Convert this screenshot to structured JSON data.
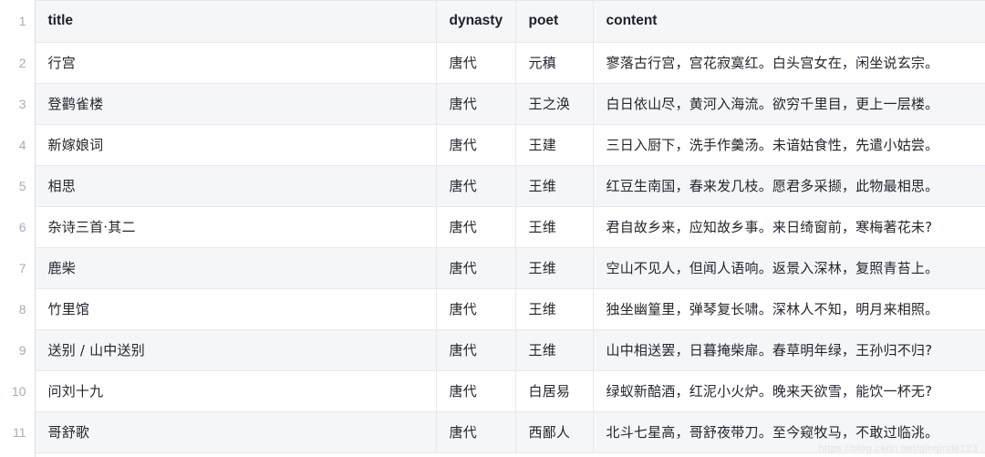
{
  "table": {
    "columns": [
      {
        "key": "title",
        "label": "title"
      },
      {
        "key": "dynasty",
        "label": "dynasty"
      },
      {
        "key": "poet",
        "label": "poet"
      },
      {
        "key": "content",
        "label": "content"
      }
    ],
    "header_row_number": "1",
    "row_numbers": [
      "2",
      "3",
      "4",
      "5",
      "6",
      "7",
      "8",
      "9",
      "10",
      "11"
    ],
    "rows": [
      {
        "n": "2",
        "title": "行宫",
        "dynasty": "唐代",
        "poet": "元稹",
        "content": "寥落古行宫，宫花寂寞红。白头宫女在，闲坐说玄宗。"
      },
      {
        "n": "3",
        "title": "登鹳雀楼",
        "dynasty": "唐代",
        "poet": "王之涣",
        "content": "白日依山尽，黄河入海流。欲穷千里目，更上一层楼。"
      },
      {
        "n": "4",
        "title": "新嫁娘词",
        "dynasty": "唐代",
        "poet": "王建",
        "content": "三日入厨下，洗手作羹汤。未谙姑食性，先遣小姑尝。"
      },
      {
        "n": "5",
        "title": "相思",
        "dynasty": "唐代",
        "poet": "王维",
        "content": "红豆生南国，春来发几枝。愿君多采撷，此物最相思。"
      },
      {
        "n": "6",
        "title": "杂诗三首·其二",
        "dynasty": "唐代",
        "poet": "王维",
        "content": "君自故乡来，应知故乡事。来日绮窗前，寒梅著花未?"
      },
      {
        "n": "7",
        "title": "鹿柴",
        "dynasty": "唐代",
        "poet": "王维",
        "content": "空山不见人，但闻人语响。返景入深林，复照青苔上。"
      },
      {
        "n": "8",
        "title": "竹里馆",
        "dynasty": "唐代",
        "poet": "王维",
        "content": "独坐幽篁里，弹琴复长啸。深林人不知，明月来相照。"
      },
      {
        "n": "9",
        "title": "送别 / 山中送别",
        "dynasty": "唐代",
        "poet": "王维",
        "content": "山中相送罢，日暮掩柴扉。春草明年绿，王孙归不归?"
      },
      {
        "n": "10",
        "title": "问刘十九",
        "dynasty": "唐代",
        "poet": "白居易",
        "content": "绿蚁新醅酒，红泥小火炉。晚来天欲雪，能饮一杯无?"
      },
      {
        "n": "11",
        "title": "哥舒歌",
        "dynasty": "唐代",
        "poet": "西鄙人",
        "content": "北斗七星高，哥舒夜带刀。至今窥牧马，不敢过临洮。"
      }
    ]
  },
  "watermark": {
    "text": "https://blog.csdn.net/qinqinde123"
  },
  "colors": {
    "stripe": "#f5f6f8",
    "plain": "#ffffff",
    "border": "#e6e9ed",
    "gutter_text": "#a4adb8",
    "cell_text": "#22272e"
  }
}
